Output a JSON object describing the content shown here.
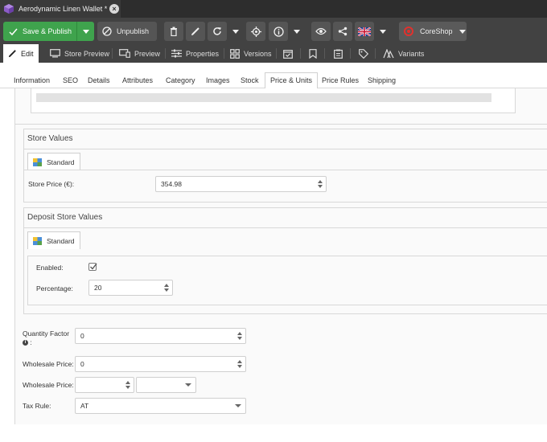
{
  "window": {
    "title": "Aerodynamic Linen Wallet *"
  },
  "toolbar": {
    "save_publish_label": "Save & Publish",
    "unpublish_label": "Unpublish",
    "coreshop_label": "CoreShop",
    "icons": [
      "trash-icon",
      "pencil-icon",
      "reload-icon",
      "chevron-down-icon",
      "target-icon",
      "info-icon",
      "chevron-down-icon",
      "eye-icon",
      "share-icon",
      "uk-flag-icon",
      "chevron-down-icon"
    ]
  },
  "view_tabs": {
    "edit": "Edit",
    "store_preview": "Store Preview",
    "preview": "Preview",
    "properties": "Properties",
    "versions": "Versions",
    "variants": "Variants"
  },
  "object_tabs": [
    "Information",
    "SEO",
    "Details",
    "Attributes",
    "Category",
    "Images",
    "Stock",
    "Price & Units",
    "Price Rules",
    "Shipping"
  ],
  "active_object_tab": "Price & Units",
  "store_values": {
    "legend": "Store Values",
    "tab_label": "Standard",
    "store_price_label": "Store Price (€):",
    "store_price_value": "354.98"
  },
  "deposit_store_values": {
    "legend": "Deposit Store Values",
    "tab_label": "Standard",
    "enabled_label": "Enabled:",
    "enabled_checked": true,
    "percentage_label": "Percentage:",
    "percentage_value": "20"
  },
  "fields": {
    "quantity_factor_label": "Quantity Factor",
    "quantity_factor_suffix": ":",
    "quantity_factor_value": "0",
    "wholesale_price_label": "Wholesale Price:",
    "wholesale_price_value": "0",
    "wholesale_price2_label": "Wholesale Price:",
    "wholesale_price2_value": "",
    "wholesale_currency_value": "",
    "tax_rule_label": "Tax Rule:",
    "tax_rule_value": "AT"
  },
  "colors": {
    "save_green": "#3fa34d",
    "toolbar_bg": "#424242",
    "coreshop_red": "#e2312d"
  }
}
